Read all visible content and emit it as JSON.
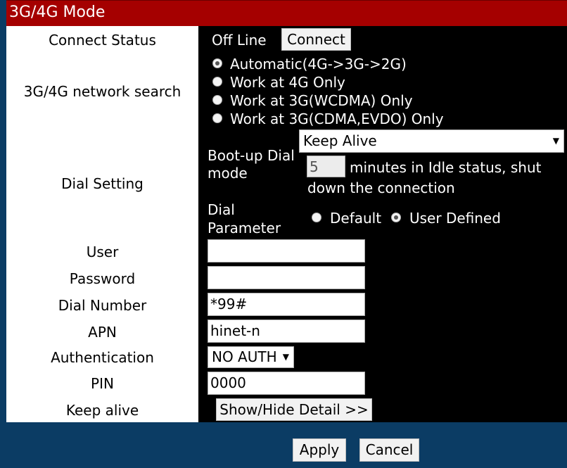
{
  "title": "3G/4G Mode",
  "labels": {
    "connect_status": "Connect Status",
    "network_search": "3G/4G network search",
    "dial_setting": "Dial Setting",
    "user": "User",
    "password": "Password",
    "dial_number": "Dial Number",
    "apn": "APN",
    "authentication": "Authentication",
    "pin": "PIN",
    "keep_alive": "Keep alive"
  },
  "connect": {
    "status": "Off Line",
    "button": "Connect"
  },
  "network_options": [
    "Automatic(4G->3G->2G)",
    "Work at 4G Only",
    "Work at 3G(WCDMA) Only",
    "Work at 3G(CDMA,EVDO) Only"
  ],
  "network_selected_index": 0,
  "bootup": {
    "label_line1": "Boot-up Dial",
    "label_line2": "mode",
    "mode_value": "Keep Alive",
    "idle_minutes": "5",
    "idle_text_line1": "minutes in Idle status, shut",
    "idle_text_line2": "down the connection"
  },
  "dial_parameter": {
    "label_line1": "Dial",
    "label_line2": "Parameter",
    "option_default": "Default",
    "option_user": "User Defined",
    "selected": "User Defined"
  },
  "fields": {
    "user": "",
    "password": "",
    "dial_number": "*99#",
    "apn": "hinet-n",
    "authentication": "NO AUTH",
    "pin": "0000"
  },
  "keep_alive_button": "Show/Hide Detail >>",
  "footer": {
    "apply": "Apply",
    "cancel": "Cancel"
  },
  "colors": {
    "title_bg": "#a50000",
    "page_bg": "#0b3c64",
    "panel_bg": "#000000",
    "label_bg": "#ffffff"
  }
}
